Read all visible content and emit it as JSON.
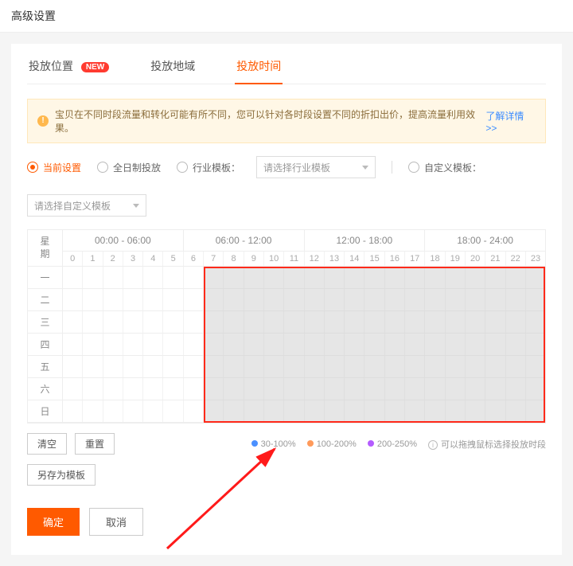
{
  "pageTitle": "高级设置",
  "tabs": [
    {
      "label": "投放位置",
      "badge": "NEW",
      "active": false
    },
    {
      "label": "投放地域",
      "active": false
    },
    {
      "label": "投放时间",
      "active": true
    }
  ],
  "notice": {
    "text": "宝贝在不同时段流量和转化可能有所不同，您可以针对各时段设置不同的折扣出价，提高流量利用效果。",
    "link": "了解详情 >>"
  },
  "modes": {
    "current": "当前设置",
    "allday": "全日制投放",
    "industry": "行业模板：",
    "industry_select": "请选择行业模板",
    "custom": "自定义模板：",
    "custom_select": "请选择自定义模板"
  },
  "schedule": {
    "corner_top": "星",
    "corner_bottom": "期",
    "ranges": [
      "00:00 - 06:00",
      "06:00 - 12:00",
      "12:00 - 18:00",
      "18:00 - 24:00"
    ],
    "hours": [
      "0",
      "1",
      "2",
      "3",
      "4",
      "5",
      "6",
      "7",
      "8",
      "9",
      "10",
      "11",
      "12",
      "13",
      "14",
      "15",
      "16",
      "17",
      "18",
      "19",
      "20",
      "21",
      "22",
      "23"
    ],
    "days": [
      "一",
      "二",
      "三",
      "四",
      "五",
      "六",
      "日"
    ],
    "selected": {
      "from_hour": 7,
      "to_hour": 24
    }
  },
  "buttons": {
    "clear": "清空",
    "reset": "重置",
    "saveas": "另存为模板",
    "ok": "确定",
    "cancel": "取消"
  },
  "legend": {
    "l1": "30-100%",
    "l2": "100-200%",
    "l3": "200-250%",
    "hint": "可以拖拽鼠标选择投放时段"
  }
}
